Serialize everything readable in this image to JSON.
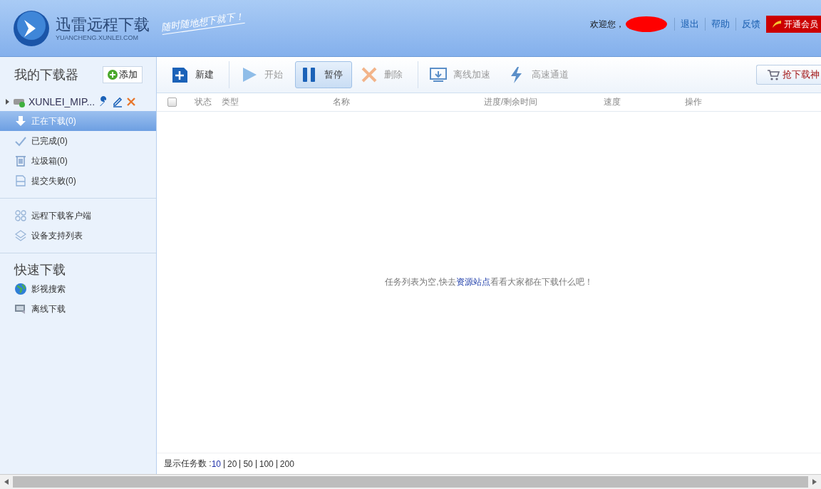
{
  "header": {
    "title": "迅雷远程下载",
    "domain": "YUANCHENG.XUNLEI.COM",
    "slogan": "随时随地想下就下！",
    "welcome": "欢迎您，",
    "links": [
      "退出",
      "帮助",
      "反馈"
    ],
    "vip_button": "开通会员"
  },
  "sidebar": {
    "title": "我的下载器",
    "add_button": "添加",
    "device": {
      "name": "XUNLEI_MIP...",
      "expanded": false
    },
    "items": [
      {
        "kind": "downloading",
        "label": "正在下载(0)",
        "selected": true
      },
      {
        "kind": "done",
        "label": "已完成(0)",
        "selected": false
      },
      {
        "kind": "trash",
        "label": "垃圾箱(0)",
        "selected": false
      },
      {
        "kind": "failed",
        "label": "提交失败(0)",
        "selected": false
      }
    ],
    "links": [
      {
        "kind": "client",
        "label": "远程下载客户端"
      },
      {
        "kind": "devices",
        "label": "设备支持列表"
      }
    ],
    "quick_title": "快速下载",
    "quick": [
      {
        "kind": "globe",
        "label": "影视搜索"
      },
      {
        "kind": "offline",
        "label": "离线下载"
      }
    ]
  },
  "toolbar": {
    "buttons": [
      {
        "kind": "new",
        "label": "新建",
        "disabled": false,
        "pressed": false
      },
      {
        "kind": "start",
        "label": "开始",
        "disabled": true,
        "pressed": false
      },
      {
        "kind": "pause",
        "label": "暂停",
        "disabled": false,
        "pressed": true
      },
      {
        "kind": "delete",
        "label": "删除",
        "disabled": true,
        "pressed": false
      },
      {
        "kind": "offline",
        "label": "离线加速",
        "disabled": true,
        "pressed": false
      },
      {
        "kind": "fast",
        "label": "高速通道",
        "disabled": true,
        "pressed": false
      }
    ],
    "shop_button": "抢下载神"
  },
  "table": {
    "select_all": {
      "checked": false
    },
    "columns": [
      "状态",
      "类型",
      "名称",
      "进度/剩余时间",
      "速度",
      "操作"
    ],
    "empty": {
      "before": "任务列表为空,快去",
      "link": "资源站点",
      "after": "看看大家都在下载什么吧！"
    }
  },
  "footer": {
    "label": "显示任务数 :",
    "page_sizes": [
      {
        "label": "10",
        "selected": true
      },
      {
        "label": "20",
        "selected": false
      },
      {
        "label": "50",
        "selected": false
      },
      {
        "label": "100",
        "selected": false
      },
      {
        "label": "200",
        "selected": false
      }
    ]
  }
}
